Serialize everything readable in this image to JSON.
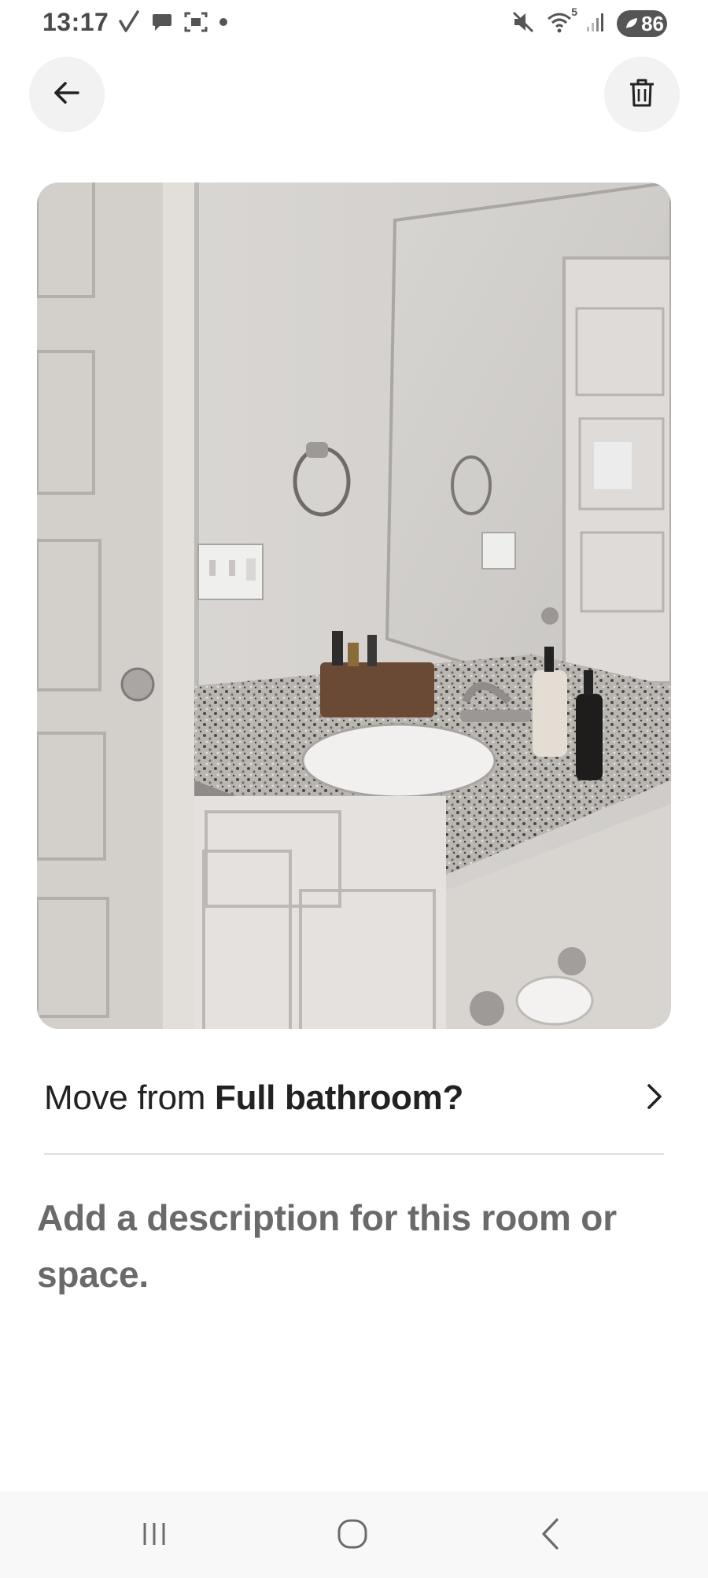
{
  "status_bar": {
    "time": "13:17",
    "battery_level": "86",
    "left_icons": [
      "check-icon",
      "chat-bubble-icon",
      "screenshot-icon",
      "dot-icon"
    ],
    "right_icons": [
      "mute-icon",
      "wifi-icon",
      "signal-icon",
      "battery-icon"
    ],
    "wifi_label": "5"
  },
  "header": {
    "back_icon": "arrow-left-icon",
    "delete_icon": "trash-icon"
  },
  "photo": {
    "subject": "bathroom-vanity-photo"
  },
  "move_row": {
    "prefix": "Move from ",
    "room": "Full bathroom?",
    "icon": "chevron-right-icon"
  },
  "description": {
    "placeholder": "Add a description for this room or space."
  },
  "nav_bar": {
    "items": [
      "recents-icon",
      "home-icon",
      "back-icon"
    ]
  },
  "colors": {
    "text_primary": "#222222",
    "text_muted": "#6a6a6a",
    "button_bg": "#f2f2f2",
    "divider": "#dddddd"
  }
}
